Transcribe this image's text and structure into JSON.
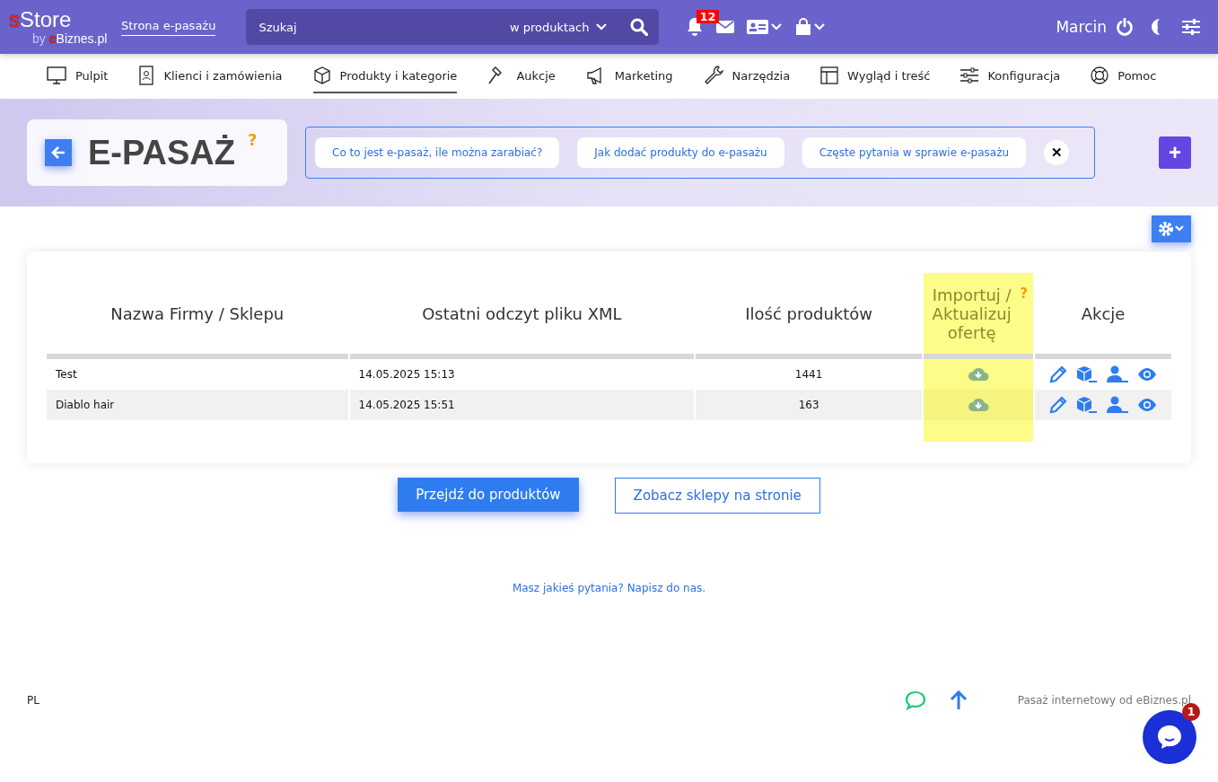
{
  "logo": {
    "mark": "s",
    "name": "Store",
    "by": "by",
    "by_mark": "e",
    "by_name": "Biznes.pl"
  },
  "header": {
    "store_link": "Strona e-pasażu",
    "search": {
      "placeholder": "Szukaj",
      "scope": "w produktach"
    },
    "notifications": "12",
    "user": "Marcin"
  },
  "nav": [
    {
      "label": "Pulpit",
      "selected": false
    },
    {
      "label": "Klienci i zamówienia",
      "selected": false
    },
    {
      "label": "Produkty i kategorie",
      "selected": true
    },
    {
      "label": "Aukcje",
      "selected": false
    },
    {
      "label": "Marketing",
      "selected": false
    },
    {
      "label": "Narzędzia",
      "selected": false
    },
    {
      "label": "Wygląd i treść",
      "selected": false
    },
    {
      "label": "Konfiguracja",
      "selected": false
    },
    {
      "label": "Pomoc",
      "selected": false
    }
  ],
  "page": {
    "title": "E-PASAŻ",
    "help": "?",
    "help_links": [
      "Co to jest e-pasaż, ile można zarabiać?",
      "Jak dodać produkty do e-pasażu",
      "Częste pytania w sprawie e-pasażu"
    ],
    "close": "✕",
    "add": "+"
  },
  "table": {
    "columns": [
      {
        "label": "Nazwa Firmy / Sklepu",
        "highlighted": false
      },
      {
        "label": "Ostatni odczyt pliku XML",
        "highlighted": false
      },
      {
        "label": "Ilość produktów",
        "highlighted": false
      },
      {
        "label": "Importuj / Aktualizuj ofertę",
        "highlighted": true,
        "help": "?"
      },
      {
        "label": "Akcje",
        "highlighted": false
      }
    ],
    "rows": [
      {
        "name": "Test",
        "last_read": "14.05.2025 15:13",
        "count": "1441"
      },
      {
        "name": "Diablo hair",
        "last_read": "14.05.2025 15:51",
        "count": "163"
      }
    ]
  },
  "buttons": {
    "primary": "Przejdź do produktów",
    "secondary": "Zobacz sklepy na stronie"
  },
  "contact_link": "Masz jakieś pytania? Napisz do nas.",
  "footer": {
    "language": "PL",
    "credit": "Pasaż internetowy od eBiznes.pl"
  },
  "chat": {
    "badge": "1"
  }
}
